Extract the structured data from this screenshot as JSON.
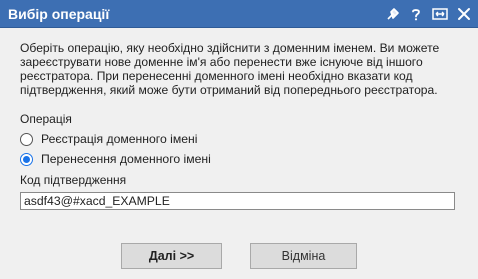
{
  "window": {
    "title": "Вибір операції",
    "title_bg": "#3d6fb3"
  },
  "titlebar_icons": [
    "pin-icon",
    "help-icon",
    "maximize-icon",
    "close-icon"
  ],
  "content": {
    "description": "Оберіть операцію, яку необхідно здійснити з доменним іменем. Ви можете зареєструвати нове доменне ім'я або перенести вже існуюче від іншого реєстратора. При перенесенні доменного імені необхідно вказати код підтвердження, який може бути отриманий від попереднього реєстратора.",
    "operation_label": "Операція",
    "options": [
      {
        "label": "Реєстрація доменного імені",
        "selected": false
      },
      {
        "label": "Перенесення доменного імені",
        "selected": true
      }
    ],
    "code_label": "Код підтвердження",
    "code_value": "asdf43@#xacd_EXAMPLE"
  },
  "buttons": {
    "next_label": "Далі >>",
    "cancel_label": "Відміна"
  },
  "colors": {
    "accent": "#1a73e8",
    "dialog_bg": "#f0f0f0"
  }
}
